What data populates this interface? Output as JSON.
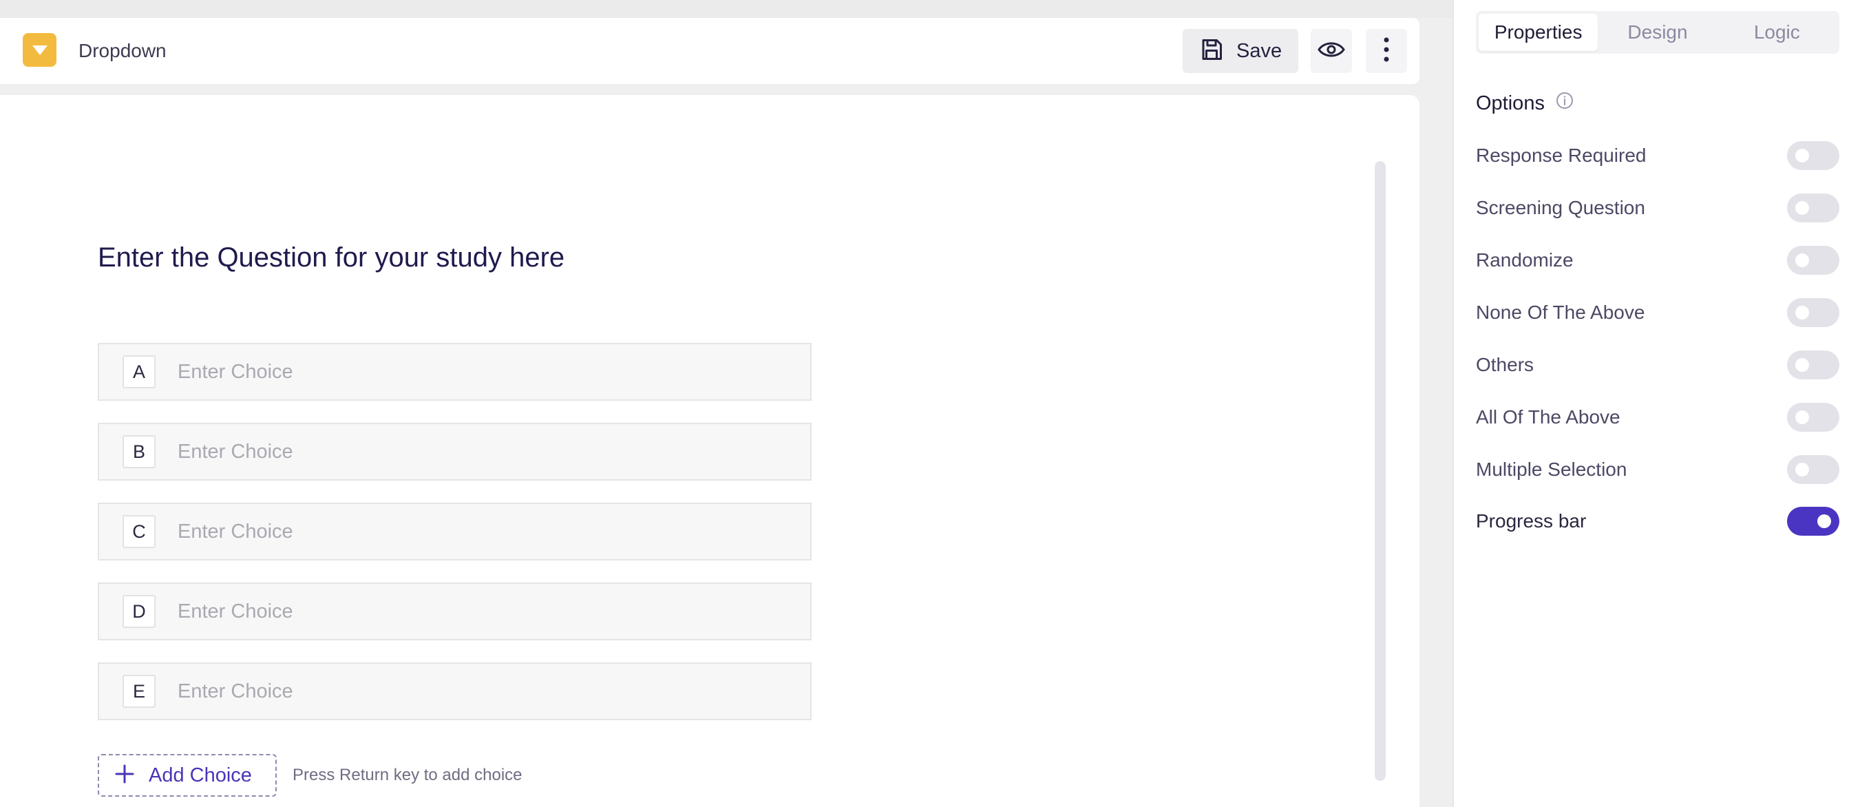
{
  "colors": {
    "accent": "#4a35c2",
    "question_type_icon_bg": "#f2bb3f",
    "page_bg": "#efeff0"
  },
  "toolbar": {
    "question_type_icon": "dropdown-triangle-icon",
    "question_type": "Dropdown",
    "save_label": "Save",
    "save_icon": "floppy-disk-icon",
    "preview_icon": "eye-icon",
    "more_icon": "vertical-dots-icon"
  },
  "editor": {
    "question_text": "Enter the Question for your study here",
    "choices": [
      {
        "letter": "A",
        "value": "",
        "placeholder": "Enter Choice"
      },
      {
        "letter": "B",
        "value": "",
        "placeholder": "Enter Choice"
      },
      {
        "letter": "C",
        "value": "",
        "placeholder": "Enter Choice"
      },
      {
        "letter": "D",
        "value": "",
        "placeholder": "Enter Choice"
      },
      {
        "letter": "E",
        "value": "",
        "placeholder": "Enter Choice"
      }
    ],
    "add_choice_label": "Add Choice",
    "add_choice_icon": "plus-icon",
    "add_choice_hint": "Press Return key to add choice"
  },
  "panel": {
    "tabs": [
      {
        "label": "Properties",
        "active": true
      },
      {
        "label": "Design",
        "active": false
      },
      {
        "label": "Logic",
        "active": false
      }
    ],
    "options_title": "Options",
    "options_info_icon": "info-icon",
    "options": [
      {
        "label": "Response Required",
        "enabled": false
      },
      {
        "label": "Screening Question",
        "enabled": false
      },
      {
        "label": "Randomize",
        "enabled": false
      },
      {
        "label": "None Of The Above",
        "enabled": false
      },
      {
        "label": "Others",
        "enabled": false
      },
      {
        "label": "All Of The Above",
        "enabled": false
      },
      {
        "label": "Multiple Selection",
        "enabled": false
      },
      {
        "label": "Progress bar",
        "enabled": true
      }
    ]
  }
}
